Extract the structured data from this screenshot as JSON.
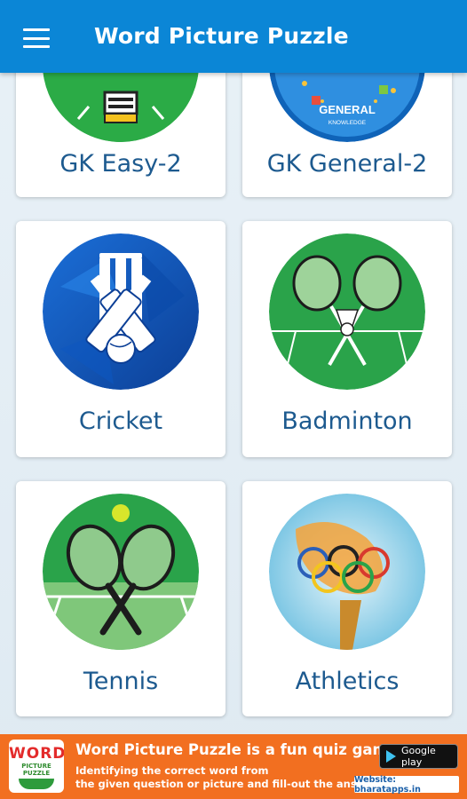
{
  "app": {
    "title": "Word Picture Puzzle",
    "menu_icon": "hamburger-menu-icon",
    "accent_color": "#0b86d6",
    "label_color": "#1d5a8f"
  },
  "categories": [
    {
      "label": "GK Easy-2",
      "icon": "lightbulb-icon"
    },
    {
      "label": "GK General-2",
      "icon": "general-knowledge-icon",
      "badge": "GENERAL",
      "badge_sub": "KNOWLEDGE"
    },
    {
      "label": "Cricket",
      "icon": "cricket-bats-wickets-icon"
    },
    {
      "label": "Badminton",
      "icon": "badminton-rackets-icon"
    },
    {
      "label": "Tennis",
      "icon": "tennis-rackets-icon"
    },
    {
      "label": "Athletics",
      "icon": "olympic-torch-icon"
    }
  ],
  "ad": {
    "logo_word": "WORD",
    "logo_sub": "PICTURE PUZZLE",
    "title": "Word Picture Puzzle is a fun quiz game.",
    "line1": "Identifying the correct word from",
    "line2": "the given question or picture and fill-out the answer.",
    "store_button": "Google play",
    "website": "Website: bharatapps.in",
    "bg_color": "#f26f20"
  }
}
